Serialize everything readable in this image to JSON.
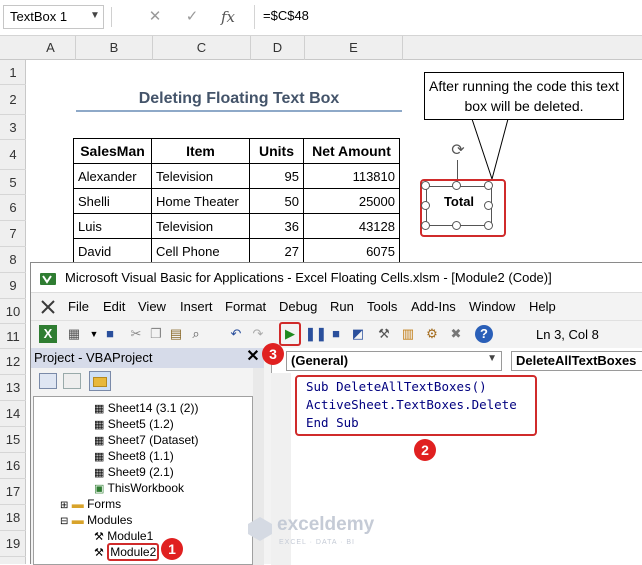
{
  "formula_bar": {
    "name_box": "TextBox 1",
    "formula": "=$C$48",
    "icons": [
      "close-icon",
      "check-icon",
      "function-icon"
    ],
    "fx_label": "fx"
  },
  "columns": [
    "A",
    "B",
    "C",
    "D",
    "E"
  ],
  "rows": [
    "1",
    "2",
    "3",
    "4",
    "5",
    "6",
    "7",
    "8",
    "9",
    "10",
    "11",
    "12",
    "13",
    "14",
    "15",
    "16",
    "17",
    "18",
    "19"
  ],
  "sheet": {
    "title": "Deleting Floating Text Box",
    "table": {
      "headers": [
        "SalesMan",
        "Item",
        "Units",
        "Net Amount"
      ],
      "rows": [
        [
          "Alexander",
          "Television",
          "95",
          "113810"
        ],
        [
          "Shelli",
          "Home Theater",
          "50",
          "25000"
        ],
        [
          "Luis",
          "Television",
          "36",
          "43128"
        ],
        [
          "David",
          "Cell Phone",
          "27",
          "6075"
        ]
      ]
    },
    "callout": "After running the code this text box will be deleted.",
    "text_box": "Total"
  },
  "vbe": {
    "title": "Microsoft Visual Basic for Applications - Excel Floating Cells.xlsm - [Module2 (Code)]",
    "menu": [
      "File",
      "Edit",
      "View",
      "Insert",
      "Format",
      "Debug",
      "Run",
      "Tools",
      "Add-Ins",
      "Window",
      "Help"
    ],
    "status": "Ln 3, Col 8",
    "project_title": "Project - VBAProject",
    "tree": [
      "Sheet14 (3.1 (2))",
      "Sheet5 (1.2)",
      "Sheet7 (Dataset)",
      "Sheet8 (1.1)",
      "Sheet9 (2.1)",
      "ThisWorkbook",
      "Forms",
      "Modules",
      "Module1",
      "Module2"
    ],
    "object_dropdown": "(General)",
    "procedure_dropdown": "DeleteAllTextBoxes",
    "code_lines": [
      "Sub DeleteAllTextBoxes()",
      "ActiveSheet.TextBoxes.Delete",
      "End Sub"
    ]
  },
  "badges": [
    "1",
    "2",
    "3"
  ],
  "watermark": {
    "name": "exceldemy",
    "tagline": "EXCEL · DATA · BI"
  },
  "colors": {
    "accent_red": "#d02b2b",
    "title_color": "#44546a",
    "code_blue": "#00007f"
  }
}
